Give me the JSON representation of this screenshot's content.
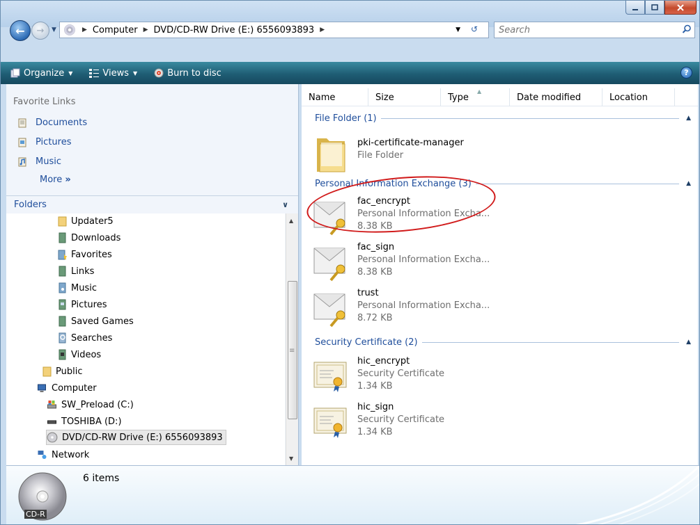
{
  "window": {
    "caption_buttons": [
      "minimize",
      "maximize",
      "close"
    ]
  },
  "address": {
    "crumbs": [
      "Computer",
      "DVD/CD-RW Drive (E:) 6556093893"
    ],
    "search_placeholder": "Search"
  },
  "toolbar": {
    "organize": "Organize",
    "views": "Views",
    "burn": "Burn to disc"
  },
  "sidebar": {
    "favorite_links_header": "Favorite Links",
    "favorites": [
      {
        "label": "Documents",
        "icon": "documents-icon"
      },
      {
        "label": "Pictures",
        "icon": "pictures-icon"
      },
      {
        "label": "Music",
        "icon": "music-icon"
      }
    ],
    "more": "More",
    "folders_header": "Folders",
    "tree": [
      {
        "label": "Updater5",
        "icon": "folder-icon"
      },
      {
        "label": "Downloads",
        "icon": "downloads-icon"
      },
      {
        "label": "Favorites",
        "icon": "favorites-icon"
      },
      {
        "label": "Links",
        "icon": "links-icon"
      },
      {
        "label": "Music",
        "icon": "music-icon"
      },
      {
        "label": "Pictures",
        "icon": "pictures-icon"
      },
      {
        "label": "Saved Games",
        "icon": "saved-games-icon"
      },
      {
        "label": "Searches",
        "icon": "searches-icon"
      },
      {
        "label": "Videos",
        "icon": "videos-icon"
      },
      {
        "label": "Public",
        "icon": "folder-icon"
      },
      {
        "label": "Computer",
        "icon": "computer-icon"
      },
      {
        "label": "SW_Preload (C:)",
        "icon": "drive-c-icon"
      },
      {
        "label": "TOSHIBA (D:)",
        "icon": "drive-d-icon"
      },
      {
        "label": "DVD/CD-RW Drive (E:) 6556093893",
        "icon": "dvd-drive-icon",
        "selected": true
      },
      {
        "label": "Network",
        "icon": "network-icon"
      }
    ]
  },
  "columns": [
    "Name",
    "Size",
    "Type",
    "Date modified",
    "Location"
  ],
  "groups": [
    {
      "title": "File Folder (1)",
      "items": [
        {
          "name": "pki-certificate-manager",
          "type": "File Folder",
          "size": "",
          "icon": "folder-icon"
        }
      ]
    },
    {
      "title": "Personal Information Exchange (3)",
      "items": [
        {
          "name": "fac_encrypt",
          "type": "Personal Information Excha...",
          "size": "8.38 KB",
          "icon": "pfx-key-icon"
        },
        {
          "name": "fac_sign",
          "type": "Personal Information Excha...",
          "size": "8.38 KB",
          "icon": "pfx-key-icon"
        },
        {
          "name": "trust",
          "type": "Personal Information Excha...",
          "size": "8.72 KB",
          "icon": "pfx-key-icon"
        }
      ]
    },
    {
      "title": "Security Certificate (2)",
      "items": [
        {
          "name": "hic_encrypt",
          "type": "Security Certificate",
          "size": "1.34 KB",
          "icon": "certificate-icon"
        },
        {
          "name": "hic_sign",
          "type": "Security Certificate",
          "size": "1.34 KB",
          "icon": "certificate-icon"
        }
      ]
    }
  ],
  "details": {
    "count": "6 items",
    "media_label": "CD-R"
  },
  "colors": {
    "link_blue": "#1e4d9b",
    "toolbar_teal": "#1f5d74",
    "annotation_red": "#d11b1b"
  }
}
